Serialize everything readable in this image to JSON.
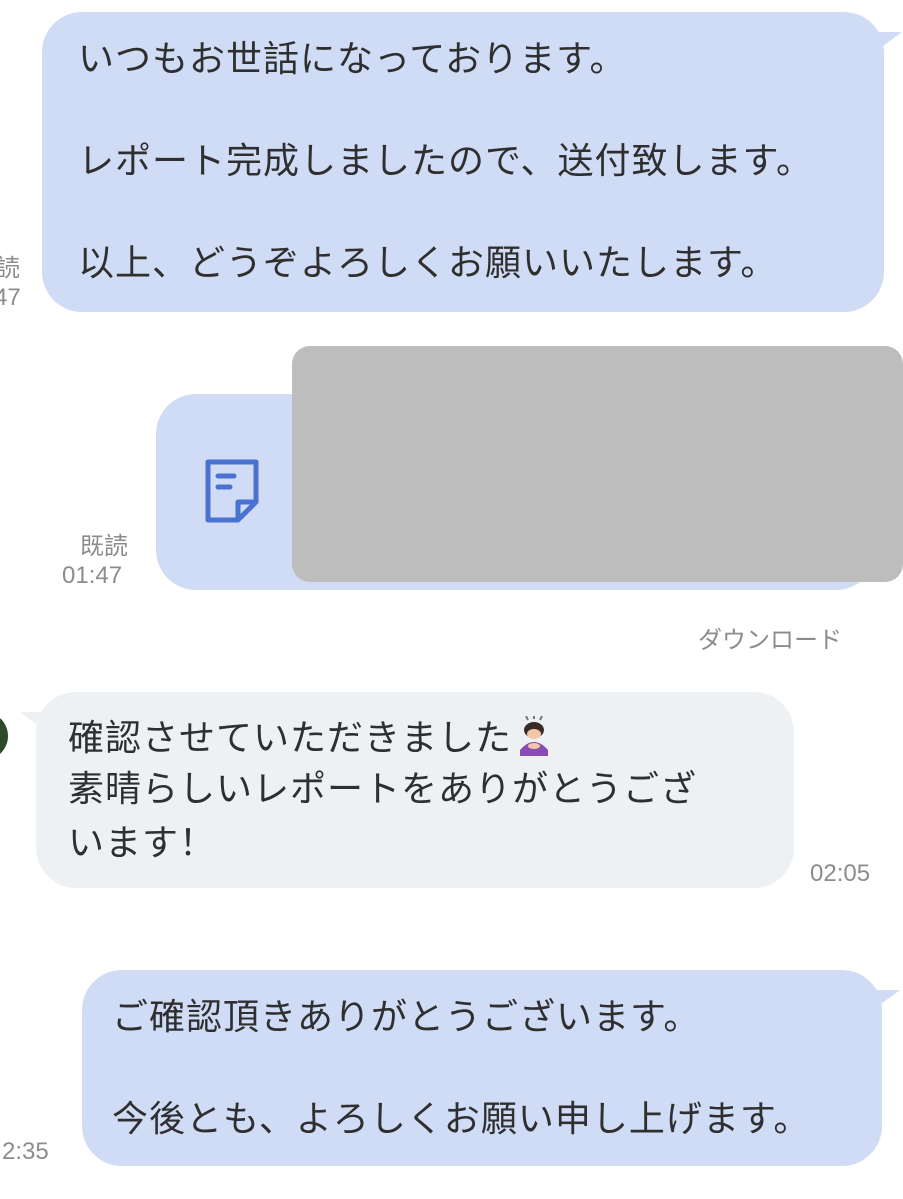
{
  "messages": [
    {
      "direction": "sent",
      "lines": [
        "いつもお世話になっております。",
        "",
        "レポート完成しましたので、送付致します。",
        "",
        "以上、どうぞよろしくお願いいたします。"
      ],
      "read_label_partial": "読",
      "time_partial": "47"
    },
    {
      "direction": "sent",
      "type": "file",
      "read_label": "既読",
      "time": "01:47",
      "download_label": "ダウンロード",
      "icon": "document-icon"
    },
    {
      "direction": "received",
      "lines": [
        "確認させていただきました",
        "素晴らしいレポートをありがとうござ",
        "います！"
      ],
      "emoji": "woman-bowing-emoji",
      "time": "02:05"
    },
    {
      "direction": "sent",
      "lines": [
        "ご確認頂きありがとうございます。",
        "",
        "今後とも、よろしくお願い申し上げます。"
      ],
      "time_partial": "2:35"
    }
  ],
  "colors": {
    "sent_bubble": "#d0dcf5",
    "received_bubble": "#eef1f4",
    "file_icon": "#4a72d0",
    "meta_text": "#8c8c8c"
  }
}
